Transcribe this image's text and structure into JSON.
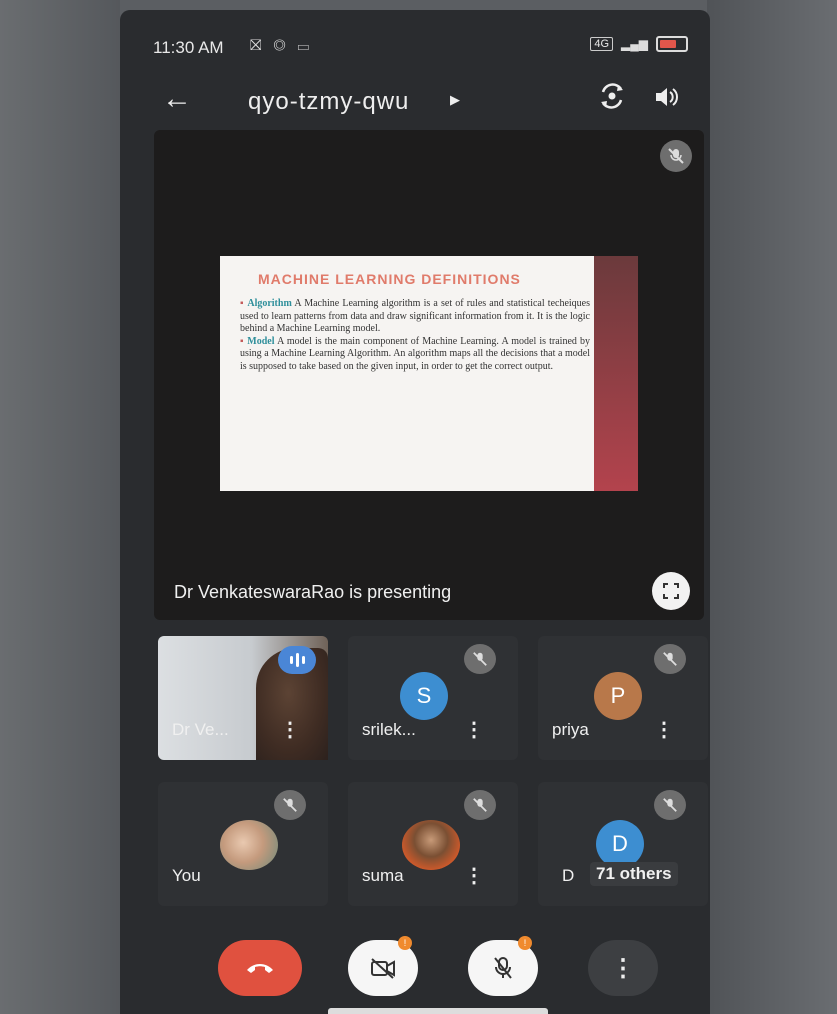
{
  "status": {
    "time": "11:30 AM",
    "left_icons": "☠Ⓢ ▭",
    "sim": "4G"
  },
  "header": {
    "meeting_code": "qyo-tzmy-qwu"
  },
  "slide": {
    "title": "MACHINE LEARNING DEFINITIONS",
    "items": [
      {
        "term": "Algorithm",
        "text": "A Machine Learning algorithm is a set of rules and statistical techeiques used to learn patterns from data and draw significant information from it. It is the logic behind a Machine Learning model."
      },
      {
        "term": "Model",
        "text": "A model is the main component of Machine Learning. A model is trained by using a Machine Learning Algorithm. An algorithm maps all the decisions that a model is supposed to take based on the given input, in order to get the correct output."
      }
    ]
  },
  "presenting": "Dr VenkateswaraRao is presenting",
  "participants": [
    {
      "name": "Dr Ve...",
      "type": "video"
    },
    {
      "name": "srilek...",
      "initial": "S",
      "color": "#3d8ed1"
    },
    {
      "name": "priya",
      "initial": "P",
      "color": "#b8784a"
    },
    {
      "name": "You",
      "type": "photo"
    },
    {
      "name": "suma",
      "type": "photo"
    },
    {
      "name": "D",
      "initial": "D",
      "color": "#3d8ed1",
      "others": "71 others"
    }
  ],
  "controls": {
    "badge_video": "!",
    "badge_mic": "!"
  },
  "colors": {
    "end_call": "#e0513f",
    "avatar_blue": "#3d8ed1",
    "avatar_brown": "#b8784a"
  }
}
